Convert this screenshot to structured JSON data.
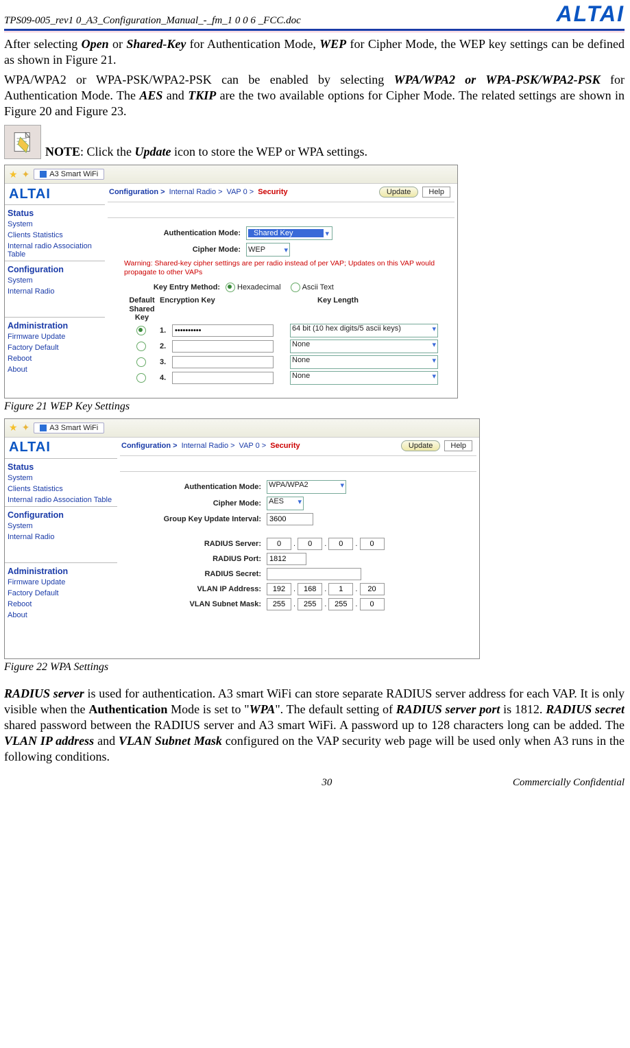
{
  "header": {
    "doc_name": "TPS09-005_rev1 0_A3_Configuration_Manual_-_fm_1 0 0 6 _FCC.doc",
    "logo_text": "ALTAI"
  },
  "para1": {
    "lead": "After selecting ",
    "b1": "Open",
    "mid1": " or ",
    "b2": "Shared-Key",
    "mid2": " for Authentication Mode, ",
    "b3": "WEP",
    "mid3": " for Cipher Mode, the WEP key settings can be defined as shown in Figure 21."
  },
  "para2": {
    "lead": "WPA/WPA2 or WPA-PSK/WPA2-PSK can be enabled by selecting ",
    "b1": "WPA/WPA2 or WPA-PSK/WPA2-PSK",
    "mid1": " for Authentication Mode. The ",
    "b2": "AES",
    "mid2": " and ",
    "b3": "TKIP",
    "mid3": " are the two available options for Cipher Mode. The related settings are shown in Figure 20 and Figure 23."
  },
  "note": {
    "label": "NOTE",
    "colon": ": Click the ",
    "b1": "Update",
    "tail": " icon to store the WEP or WPA settings."
  },
  "screenshot_common": {
    "tab_title": "A3 Smart WiFi",
    "logo": "ALTAI",
    "sidebar": {
      "status_title": "Status",
      "status_links": [
        "System",
        "Clients Statistics",
        "Internal radio Association Table"
      ],
      "config_title": "Configuration",
      "config_links": [
        "System",
        "Internal Radio"
      ],
      "admin_title": "Administration",
      "admin_links": [
        "Firmware Update",
        "Factory Default",
        "Reboot",
        "About"
      ]
    },
    "breadcrumb": {
      "seg1": "Configuration >",
      "seg2": "Internal Radio >",
      "seg3": "VAP 0 >",
      "seg4": "Security"
    },
    "update_btn": "Update",
    "help_btn": "Help"
  },
  "fig21": {
    "caption": "Figure 21     WEP Key Settings",
    "auth_mode_label": "Authentication Mode:",
    "auth_mode_value": "Shared Key",
    "cipher_label": "Cipher Mode:",
    "cipher_value": "WEP",
    "warning": "Warning: Shared-key cipher settings are per radio instead of per VAP; Updates on this VAP would propagate to other VAPs",
    "key_entry_label": "Key Entry Method:",
    "key_entry_opt1": "Hexadecimal",
    "key_entry_opt2": "Ascii Text",
    "col_default": "Default Shared Key",
    "col_enc": "Encryption Key",
    "col_len": "Key Length",
    "rows": [
      {
        "num": "1.",
        "key": "••••••••••",
        "len": "64 bit (10 hex digits/5 ascii keys)",
        "selected": true
      },
      {
        "num": "2.",
        "key": "",
        "len": "None",
        "selected": false
      },
      {
        "num": "3.",
        "key": "",
        "len": "None",
        "selected": false
      },
      {
        "num": "4.",
        "key": "",
        "len": "None",
        "selected": false
      }
    ]
  },
  "fig22": {
    "caption": "Figure 22     WPA Settings",
    "auth_mode_label": "Authentication Mode:",
    "auth_mode_value": "WPA/WPA2",
    "cipher_label": "Cipher Mode:",
    "cipher_value": "AES",
    "gku_label": "Group Key Update Interval:",
    "gku_value": "3600",
    "radius_server_label": "RADIUS Server:",
    "radius_server_value": [
      "0",
      "0",
      "0",
      "0"
    ],
    "radius_port_label": "RADIUS Port:",
    "radius_port_value": "1812",
    "radius_secret_label": "RADIUS Secret:",
    "radius_secret_value": "",
    "vlan_ip_label": "VLAN IP Address:",
    "vlan_ip_value": [
      "192",
      "168",
      "1",
      "20"
    ],
    "vlan_mask_label": "VLAN Subnet Mask:",
    "vlan_mask_value": [
      "255",
      "255",
      "255",
      "0"
    ]
  },
  "para3": {
    "b1": "RADIUS server",
    "t1": " is used for authentication. A3 smart WiFi can store separate RADIUS server address for each VAP. It is only visible when the ",
    "b2": "Authentication",
    "t2": " Mode is set to \"",
    "b3": "WPA",
    "t3": "\". The default setting of ",
    "b4": "RADIUS server port",
    "t4": " is 1812. ",
    "b5": "RADIUS secret",
    "t5": " shared password between the RADIUS server and A3 smart WiFi. A password up to 128 characters long can be added. The ",
    "b6": "VLAN IP address",
    "t6": " and ",
    "b7": "VLAN Subnet Mask",
    "t7": " configured on the VAP security web page will be used only when A3 runs in the following conditions."
  },
  "footer": {
    "page": "30",
    "conf": "Commercially Confidential"
  }
}
